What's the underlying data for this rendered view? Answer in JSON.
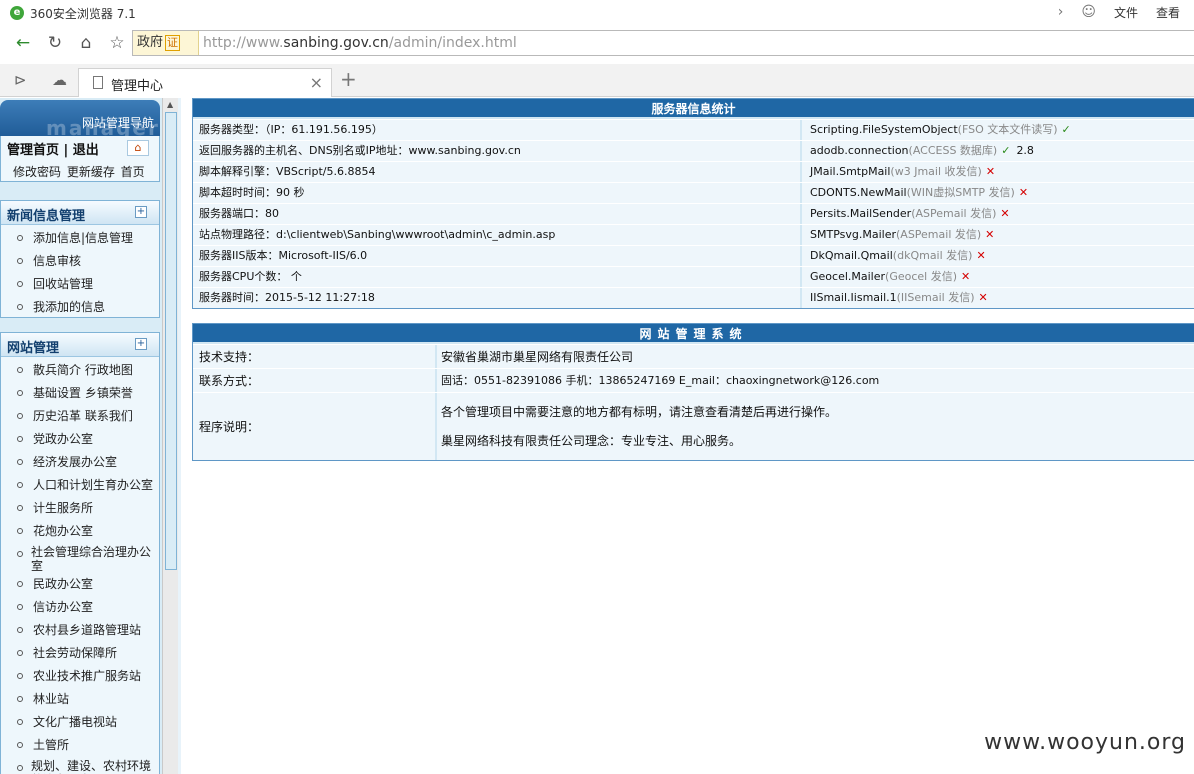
{
  "browser": {
    "app_title": "360安全浏览器 7.1",
    "menu": [
      "文件",
      "查看"
    ],
    "cert_label": "政府",
    "cert_badge": "证",
    "url_prefix": "http://www.",
    "url_domain": "sanbing.gov.cn",
    "url_path": "/admin/index.html",
    "tab_title": "管理中心"
  },
  "sidebar": {
    "header_title": "网站管理导航",
    "header_watermark": "manager",
    "home_links": "管理首页 | 退出",
    "home_sub": "修改密码 更新缓存 首页",
    "news_title": "新闻信息管理",
    "news_items": [
      "添加信息|信息管理",
      "信息审核",
      "回收站管理",
      "我添加的信息"
    ],
    "site_title": "网站管理",
    "site_items": [
      "散兵简介 行政地图",
      "基础设置 乡镇荣誉",
      "历史沿革 联系我们",
      "党政办公室",
      "经济发展办公室",
      "人口和计划生育办公室",
      "计生服务所",
      "花炮办公室",
      "社会管理综合治理办公室",
      "民政办公室",
      "信访办公室",
      "农村县乡道路管理站",
      "社会劳动保障所",
      "农业技术推广服务站",
      "林业站",
      "文化广播电视站",
      "土管所",
      "规划、建设、农村环境整治办公室"
    ]
  },
  "server": {
    "title": "服务器信息统计",
    "rows": [
      {
        "left": "服务器类型：（IP：61.191.56.195）",
        "comp": "Scripting.FileSystemObject",
        "desc": "(FSO 文本文件读写)",
        "ok": true,
        "extra": ""
      },
      {
        "left": "返回服务器的主机名、DNS别名或IP地址：www.sanbing.gov.cn",
        "comp": "adodb.connection",
        "desc": "(ACCESS 数据库)",
        "ok": true,
        "extra": "2.8"
      },
      {
        "left": "脚本解释引擎：VBScript/5.6.8854",
        "comp": "JMail.SmtpMail",
        "desc": "(w3 Jmail 收发信)",
        "ok": false,
        "extra": ""
      },
      {
        "left": "脚本超时时间：90 秒",
        "comp": "CDONTS.NewMail",
        "desc": "(WIN虚拟SMTP 发信)",
        "ok": false,
        "extra": ""
      },
      {
        "left": "服务器端口：80",
        "comp": "Persits.MailSender",
        "desc": "(ASPemail 发信)",
        "ok": false,
        "extra": ""
      },
      {
        "left": "站点物理路径：d:\\clientweb\\Sanbing\\wwwroot\\admin\\c_admin.asp",
        "comp": "SMTPsvg.Mailer",
        "desc": "(ASPemail 发信)",
        "ok": false,
        "extra": ""
      },
      {
        "left": "服务器IIS版本：Microsoft-IIS/6.0",
        "comp": "DkQmail.Qmail",
        "desc": "(dkQmail 发信)",
        "ok": false,
        "extra": ""
      },
      {
        "left": "服务器CPU个数： 个",
        "comp": "Geocel.Mailer",
        "desc": "(Geocel 发信)",
        "ok": false,
        "extra": ""
      },
      {
        "left": "服务器时间：2015-5-12 11:27:18",
        "comp": "IISmail.Iismail.1",
        "desc": "(IISemail 发信)",
        "ok": false,
        "extra": ""
      }
    ]
  },
  "system": {
    "title": "网站管理系统",
    "support_label": "技术支持：",
    "support_value": "安徽省巢湖市巢星网络有限责任公司",
    "contact_label": "联系方式：",
    "contact_value": "固话：0551-82391086 手机：13865247169 E_mail：chaoxingnetwork@126.com",
    "note_label": "程序说明：",
    "note_line1": "各个管理项目中需要注意的地方都有标明，请注意查看清楚后再进行操作。",
    "note_line2": "巢星网络科技有限责任公司理念：专业专注、用心服务。"
  },
  "watermark": "www.wooyun.org",
  "colors": {
    "header_blue": "#1f67a5",
    "panel_bg": "#eef6fb",
    "ok_green": "#2a8a1a",
    "no_red": "#d40000"
  }
}
